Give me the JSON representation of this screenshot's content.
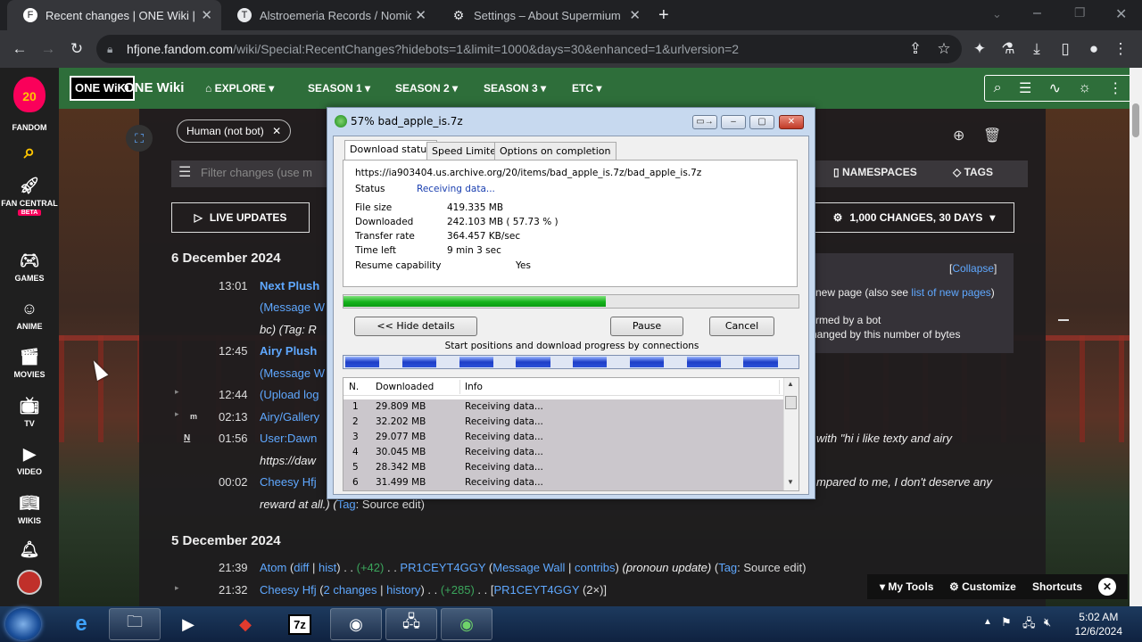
{
  "browser": {
    "tabs": [
      {
        "title": "Recent changes | ONE Wiki | Fan",
        "favicon": "F"
      },
      {
        "title": "Alstroemeria Records / Nomico",
        "favicon": "T"
      },
      {
        "title": "Settings – About Supermium",
        "favicon": "⚙"
      }
    ],
    "url_host": "hfjone.fandom.com",
    "url_path": "/wiki/Special:RecentChanges?hidebots=1&limit=1000&days=30&enhanced=1&urlversion=2"
  },
  "fandom_sidebar": {
    "logo_number": "20",
    "items": [
      "FANDOM",
      "FAN CENTRAL",
      "GAMES",
      "ANIME",
      "MOVIES",
      "TV",
      "VIDEO",
      "WIKIS"
    ],
    "beta_badge": "BETA"
  },
  "wiki_nav": {
    "logo_text": "ONE WiKi",
    "site_name": "ONE Wiki",
    "links": [
      "EXPLORE",
      "SEASON 1",
      "SEASON 2",
      "SEASON 3",
      "ETC"
    ]
  },
  "rc": {
    "filter_pill": "Human (not bot)",
    "filter_placeholder": "Filter changes (use m",
    "namespaces": "NAMESPACES",
    "tags": "TAGS",
    "live_updates": "LIVE UPDATES",
    "changes_summary": "1,000 CHANGES, 30 DAYS",
    "collapse": "Collapse",
    "legend": {
      "l1a": "new page (also see ",
      "l1b": "list of new pages",
      "l1c": ")",
      "l2": "rmed by a bot",
      "l3": "hanged by this number of bytes"
    },
    "day1": "6 December 2024",
    "day1_rows": [
      {
        "time": "13:01",
        "title": "Next Plush"
      },
      {
        "time": "",
        "title": "(Message W"
      },
      {
        "time": "",
        "title": "bc) (Tag: R"
      },
      {
        "time": "12:45",
        "title": "Airy Plush"
      },
      {
        "time": "",
        "title": "(Message W"
      },
      {
        "time": "12:44",
        "title": "(Upload log"
      },
      {
        "time": "02:13",
        "title": "Airy/Gallery"
      },
      {
        "time": "01:56",
        "title": "User:Dawn"
      },
      {
        "time": "",
        "title": "https://daw"
      },
      {
        "time": "00:02",
        "title": "Cheesy Hfj"
      }
    ],
    "row_0156_tail": "with \"hi i like texty and airy",
    "row_0002_tail": "mpared to me, I don't deserve any",
    "row_0002_line2a": "reward at all.) (",
    "row_0002_tag": "Tag",
    "row_0002_line2b": ": Source edit)",
    "day2": "5 December 2024",
    "row_2139": {
      "time": "21:39",
      "title": "Atom",
      "diff": "diff",
      "hist": "hist",
      "bytes": "(+42)",
      "user": "PR1CEYT4GGY",
      "wall": "Message Wall",
      "contribs": "contribs",
      "summary": "(pronoun update)",
      "tag_label": "Tag",
      "tag_value": ": Source edit)"
    },
    "row_2132": {
      "time": "21:32",
      "title": "Cheesy Hfj",
      "changes": "2 changes",
      "history": "history",
      "bytes": "(+285)",
      "user": "PR1CEYT4GGY",
      "count": "(2×)"
    }
  },
  "bottom_tools": {
    "my_tools": "My Tools",
    "customize": "Customize",
    "shortcuts": "Shortcuts"
  },
  "download_dialog": {
    "title": "57% bad_apple_is.7z",
    "tabs": [
      "Download status",
      "Speed Limiter",
      "Options on completion"
    ],
    "url": "https://ia903404.us.archive.org/20/items/bad_apple_is.7z/bad_apple_is.7z",
    "status_label": "Status",
    "status_value": "Receiving data...",
    "file_size_label": "File size",
    "file_size": "419.335  MB",
    "downloaded_label": "Downloaded",
    "downloaded": "242.103  MB  ( 57.73 % )",
    "rate_label": "Transfer rate",
    "rate": "364.457  KB/sec",
    "time_left_label": "Time left",
    "time_left": "9 min 3 sec",
    "resume_label": "Resume capability",
    "resume": "Yes",
    "progress_fraction": 0.5773,
    "hide_details": "<< Hide details",
    "pause": "Pause",
    "cancel": "Cancel",
    "connections_caption": "Start positions and download progress by connections",
    "list_headers": [
      "N.",
      "Downloaded",
      "Info"
    ],
    "connections": [
      {
        "n": "1",
        "downloaded": "29.809  MB",
        "info": "Receiving data..."
      },
      {
        "n": "2",
        "downloaded": "32.202  MB",
        "info": "Receiving data..."
      },
      {
        "n": "3",
        "downloaded": "29.077  MB",
        "info": "Receiving data..."
      },
      {
        "n": "4",
        "downloaded": "30.045  MB",
        "info": "Receiving data..."
      },
      {
        "n": "5",
        "downloaded": "28.342  MB",
        "info": "Receiving data..."
      },
      {
        "n": "6",
        "downloaded": "31.499  MB",
        "info": "Receiving data..."
      }
    ]
  },
  "taskbar": {
    "clock_time": "5:02 AM",
    "clock_date": "12/6/2024",
    "apps": [
      "ie-icon",
      "explorer-icon",
      "media-player-icon",
      "red-app-icon",
      "7zip-icon",
      "browser-icon",
      "network-icon",
      "idm-icon"
    ]
  }
}
